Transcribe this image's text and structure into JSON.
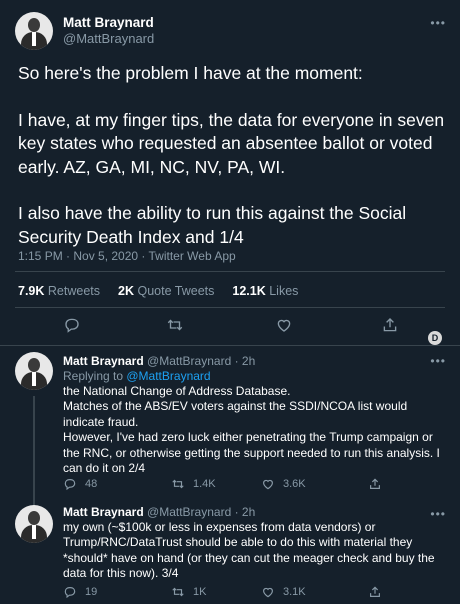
{
  "main_tweet": {
    "author_name": "Matt Braynard",
    "author_handle": "@MattBraynard",
    "text": "So here's the problem I have at the moment:\n\nI have, at my finger tips, the data for everyone in seven key states who requested an absentee ballot or voted early. AZ, GA, MI, NC, NV, PA, WI.\n\nI also have the ability to run this against the Social Security Death Index and 1/4",
    "meta": "1:15 PM · Nov 5, 2020 · Twitter Web App",
    "stats": {
      "retweets_count": "7.9K",
      "retweets_label": "Retweets",
      "quotes_count": "2K",
      "quotes_label": "Quote Tweets",
      "likes_count": "12.1K",
      "likes_label": "Likes"
    }
  },
  "replies": [
    {
      "author_name": "Matt Braynard",
      "author_handle": "@MattBraynard · 2h",
      "replying_prefix": "Replying to ",
      "replying_handle": "@MattBraynard",
      "text": "the National Change of Address Database.\nMatches of the ABS/EV voters against the SSDI/NCOA list would indicate fraud.\nHowever, I've had zero luck either penetrating the Trump campaign or the RNC, or otherwise getting the support needed to run this analysis. I can do it on 2/4",
      "reply_count": "48",
      "retweet_count": "1.4K",
      "like_count": "3.6K"
    },
    {
      "author_name": "Matt Braynard",
      "author_handle": "@MattBraynard · 2h",
      "text": "my own (~$100k or less in expenses from data vendors) or Trump/RNC/DataTrust should be able to do this with material they *should* have on hand (or they can cut the meager check and buy the data for this now). 3/4",
      "reply_count": "19",
      "retweet_count": "1K",
      "like_count": "3.1K"
    }
  ],
  "icons": [
    "reply-icon",
    "retweet-icon",
    "like-icon",
    "share-icon",
    "more-icon"
  ],
  "badge_letter": "D",
  "colors": {
    "background": "#15202b",
    "muted": "#8899a6",
    "link": "#1da1f2",
    "divider": "#38444d"
  }
}
